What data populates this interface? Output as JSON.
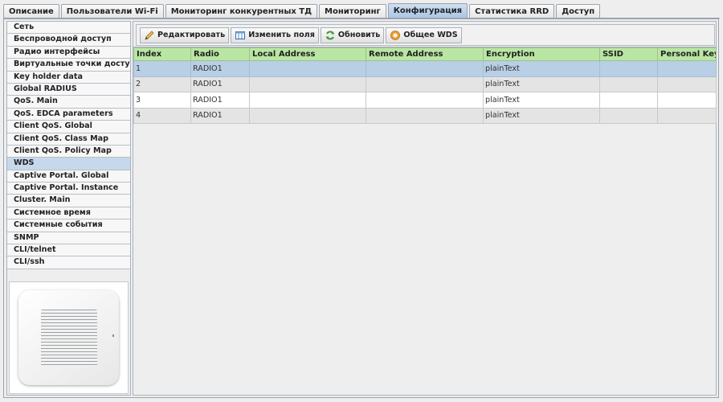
{
  "tabs": [
    {
      "label": "Описание"
    },
    {
      "label": "Пользователи Wi-Fi"
    },
    {
      "label": "Мониторинг конкурентных ТД"
    },
    {
      "label": "Мониторинг"
    },
    {
      "label": "Конфигурация",
      "active": true
    },
    {
      "label": "Статистика RRD"
    },
    {
      "label": "Доступ"
    }
  ],
  "sidebar": {
    "items": [
      {
        "label": "Сеть"
      },
      {
        "label": "Беспроводной доступ"
      },
      {
        "label": "Радио интерфейсы"
      },
      {
        "label": "Виртуальные точки доступа"
      },
      {
        "label": "Key holder data"
      },
      {
        "label": "Global RADIUS"
      },
      {
        "label": "QoS. Main"
      },
      {
        "label": "QoS. EDCA parameters"
      },
      {
        "label": "Client QoS. Global"
      },
      {
        "label": "Client QoS. Class Map"
      },
      {
        "label": "Client QoS. Policy Map"
      },
      {
        "label": "WDS",
        "active": true
      },
      {
        "label": "Captive Portal. Global"
      },
      {
        "label": "Captive Portal. Instance"
      },
      {
        "label": "Cluster. Main"
      },
      {
        "label": "Системное время"
      },
      {
        "label": "Системные события"
      },
      {
        "label": "SNMP"
      },
      {
        "label": "CLI/telnet"
      },
      {
        "label": "CLI/ssh"
      }
    ]
  },
  "toolbar": {
    "edit_label": "Редактировать",
    "edit_icon": "pencil-icon",
    "fields_label": "Изменить поля",
    "fields_icon": "columns-icon",
    "refresh_label": "Обновить",
    "refresh_icon": "refresh-icon",
    "general_wds_label": "Общее WDS",
    "general_wds_icon": "settings-circle-icon"
  },
  "table": {
    "columns": [
      "Index",
      "Radio",
      "Local Address",
      "Remote Address",
      "Encryption",
      "SSID",
      "Personal Key"
    ],
    "rows": [
      {
        "cells": [
          "1",
          "RADIO1",
          "",
          "",
          "plainText",
          "",
          ""
        ],
        "selected": true
      },
      {
        "cells": [
          "2",
          "RADIO1",
          "",
          "",
          "plainText",
          "",
          ""
        ]
      },
      {
        "cells": [
          "3",
          "RADIO1",
          "",
          "",
          "plainText",
          "",
          ""
        ]
      },
      {
        "cells": [
          "4",
          "RADIO1",
          "",
          "",
          "plainText",
          "",
          ""
        ]
      }
    ]
  },
  "colors": {
    "header_green": "#b9e6a3",
    "selected_row": "#b8cfe6",
    "active_tab": "#aac7e6"
  }
}
